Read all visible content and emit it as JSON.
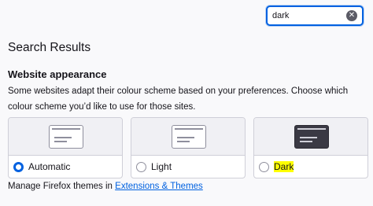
{
  "search": {
    "value": "dark"
  },
  "page_title": "Search Results",
  "section": {
    "heading": "Website appearance",
    "description": "Some websites adapt their colour scheme based on your preferences. Choose which colour scheme you’d like to use for those sites."
  },
  "options": [
    {
      "label": "Automatic",
      "selected": true
    },
    {
      "label": "Light",
      "selected": false
    },
    {
      "label": "Dark",
      "selected": false,
      "highlighted": true
    }
  ],
  "footer": {
    "text": "Manage Firefox themes in ",
    "link": "Extensions & Themes"
  },
  "colors": {
    "accent": "#0061e0",
    "highlight": "#ffff00",
    "dark_preview": "#3a3944"
  },
  "icons": {
    "clear": "clear-icon",
    "radio": "radio-icon"
  }
}
